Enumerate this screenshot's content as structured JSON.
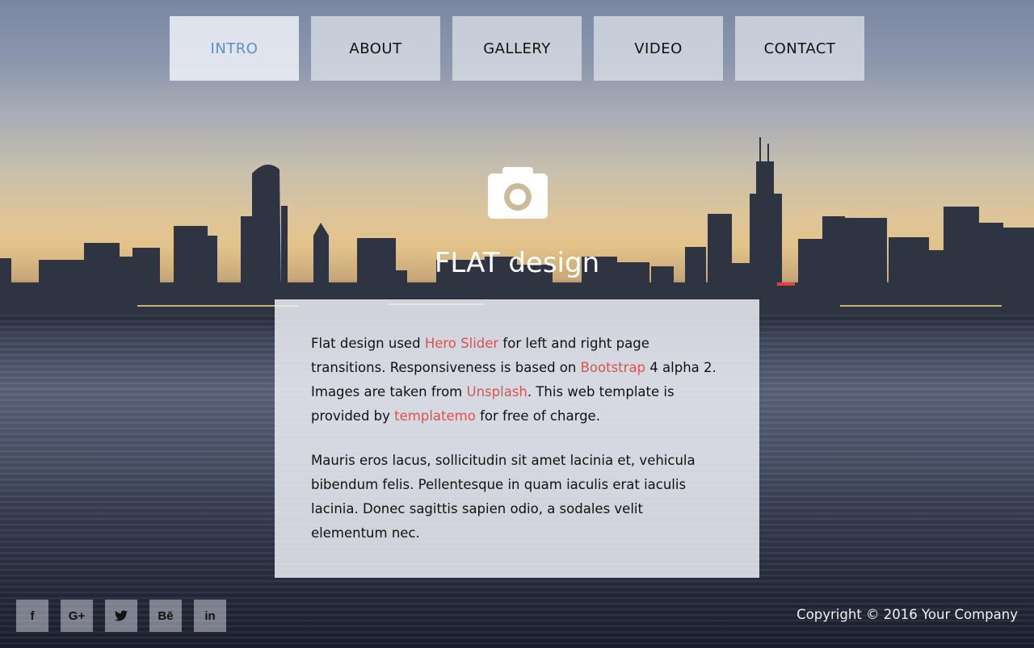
{
  "nav": {
    "items": [
      {
        "label": "INTRO"
      },
      {
        "label": "ABOUT"
      },
      {
        "label": "GALLERY"
      },
      {
        "label": "VIDEO"
      },
      {
        "label": "CONTACT"
      }
    ],
    "active_color": "#5b8fd1"
  },
  "hero": {
    "icon": "camera-icon",
    "title": "FLAT design"
  },
  "content": {
    "p1": {
      "t1": "Flat design used ",
      "link1": "Hero Slider",
      "t2": " for left and right page transitions. Responsiveness is based on ",
      "link2": "Bootstrap",
      "t3": " 4 alpha 2. Images are taken from ",
      "link3": "Unsplash",
      "t4": ". This web template is provided by ",
      "link4": "templatemo",
      "t5": " for free of charge."
    },
    "p2": "Mauris eros lacus, sollicitudin sit amet lacinia et, vehicula bibendum felis. Pellentesque in quam iaculis erat iaculis lacinia. Donec sagittis sapien odio, a sodales velit elementum nec.",
    "link_color": "#d9534f"
  },
  "social": {
    "items": [
      {
        "icon": "facebook-icon",
        "glyph": "f"
      },
      {
        "icon": "google-plus-icon",
        "glyph": "G+"
      },
      {
        "icon": "twitter-icon",
        "glyph": "🐦"
      },
      {
        "icon": "behance-icon",
        "glyph": "Bē"
      },
      {
        "icon": "linkedin-icon",
        "glyph": "in"
      }
    ]
  },
  "footer": {
    "copyright": "Copyright © 2016 Your Company"
  }
}
